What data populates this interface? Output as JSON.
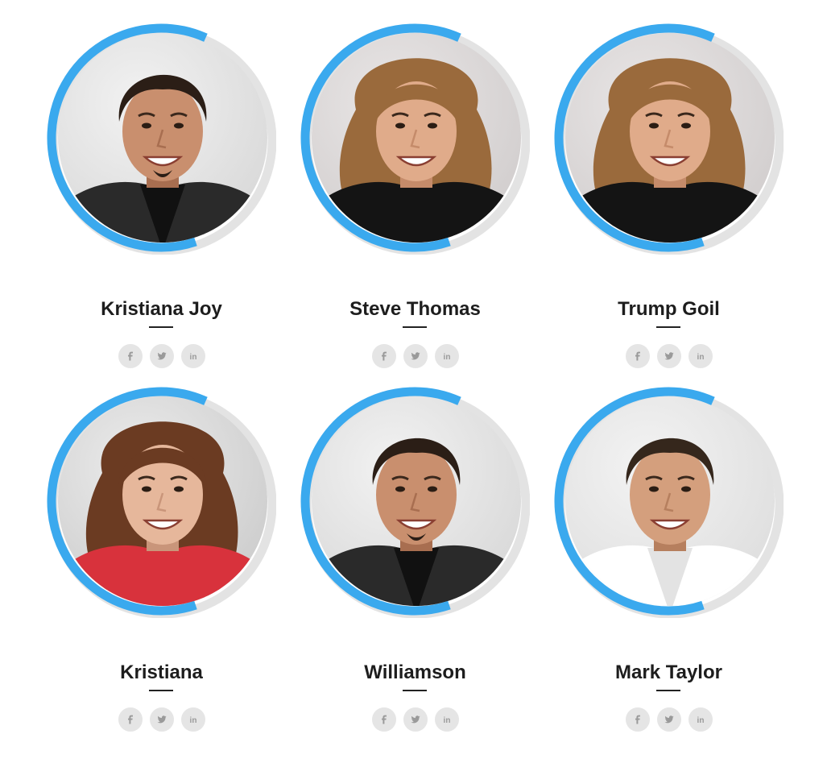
{
  "accent_color": "#3aa9ee",
  "ring_track_color": "#e3e3e3",
  "icon_color": "#9a9a9a",
  "members": [
    {
      "name": "Kristiana Joy",
      "skill_level": 0.62,
      "portrait": "man-dark-jacket",
      "social": [
        "facebook-icon",
        "twitter-icon",
        "linkedin-icon"
      ]
    },
    {
      "name": "Steve Thomas",
      "skill_level": 0.62,
      "portrait": "woman-curly-hair",
      "social": [
        "facebook-icon",
        "twitter-icon",
        "linkedin-icon"
      ]
    },
    {
      "name": "Trump Goil",
      "skill_level": 0.62,
      "portrait": "woman-curly-hair",
      "social": [
        "facebook-icon",
        "twitter-icon",
        "linkedin-icon"
      ]
    },
    {
      "name": "Kristiana",
      "skill_level": 0.62,
      "portrait": "woman-red-top",
      "social": [
        "facebook-icon",
        "twitter-icon",
        "linkedin-icon"
      ]
    },
    {
      "name": "Williamson",
      "skill_level": 0.62,
      "portrait": "man-dark-jacket",
      "social": [
        "facebook-icon",
        "twitter-icon",
        "linkedin-icon"
      ]
    },
    {
      "name": "Mark Taylor",
      "skill_level": 0.62,
      "portrait": "man-white-shirt",
      "social": [
        "facebook-icon",
        "twitter-icon",
        "linkedin-icon"
      ]
    }
  ]
}
